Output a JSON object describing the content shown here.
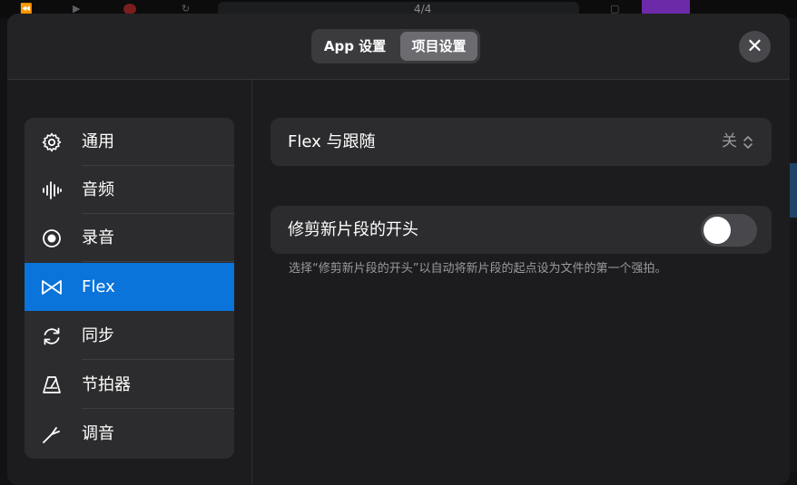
{
  "header": {
    "segments": [
      {
        "label": "App 设置",
        "selected": false
      },
      {
        "label": "项目设置",
        "selected": true
      }
    ],
    "close_icon": "close-icon"
  },
  "background": {
    "time_signature": "4/4"
  },
  "sidebar": {
    "items": [
      {
        "label": "通用",
        "icon": "gear-icon",
        "active": false
      },
      {
        "label": "音频",
        "icon": "waveform-icon",
        "active": false
      },
      {
        "label": "录音",
        "icon": "record-icon",
        "active": false
      },
      {
        "label": "Flex",
        "icon": "flex-icon",
        "active": true
      },
      {
        "label": "同步",
        "icon": "sync-icon",
        "active": false
      },
      {
        "label": "节拍器",
        "icon": "metronome-icon",
        "active": false
      },
      {
        "label": "调音",
        "icon": "tuning-icon",
        "active": false
      }
    ]
  },
  "content": {
    "flex_follow": {
      "label": "Flex 与跟随",
      "value": "关"
    },
    "trim_start": {
      "label": "修剪新片段的开头",
      "on": false
    },
    "hint": "选择“修剪新片段的开头”以自动将新片段的起点设为文件的第一个强拍。"
  },
  "colors": {
    "accent": "#0a74da",
    "sheet_bg": "#1c1c1e",
    "row_bg": "#2c2c2e"
  }
}
